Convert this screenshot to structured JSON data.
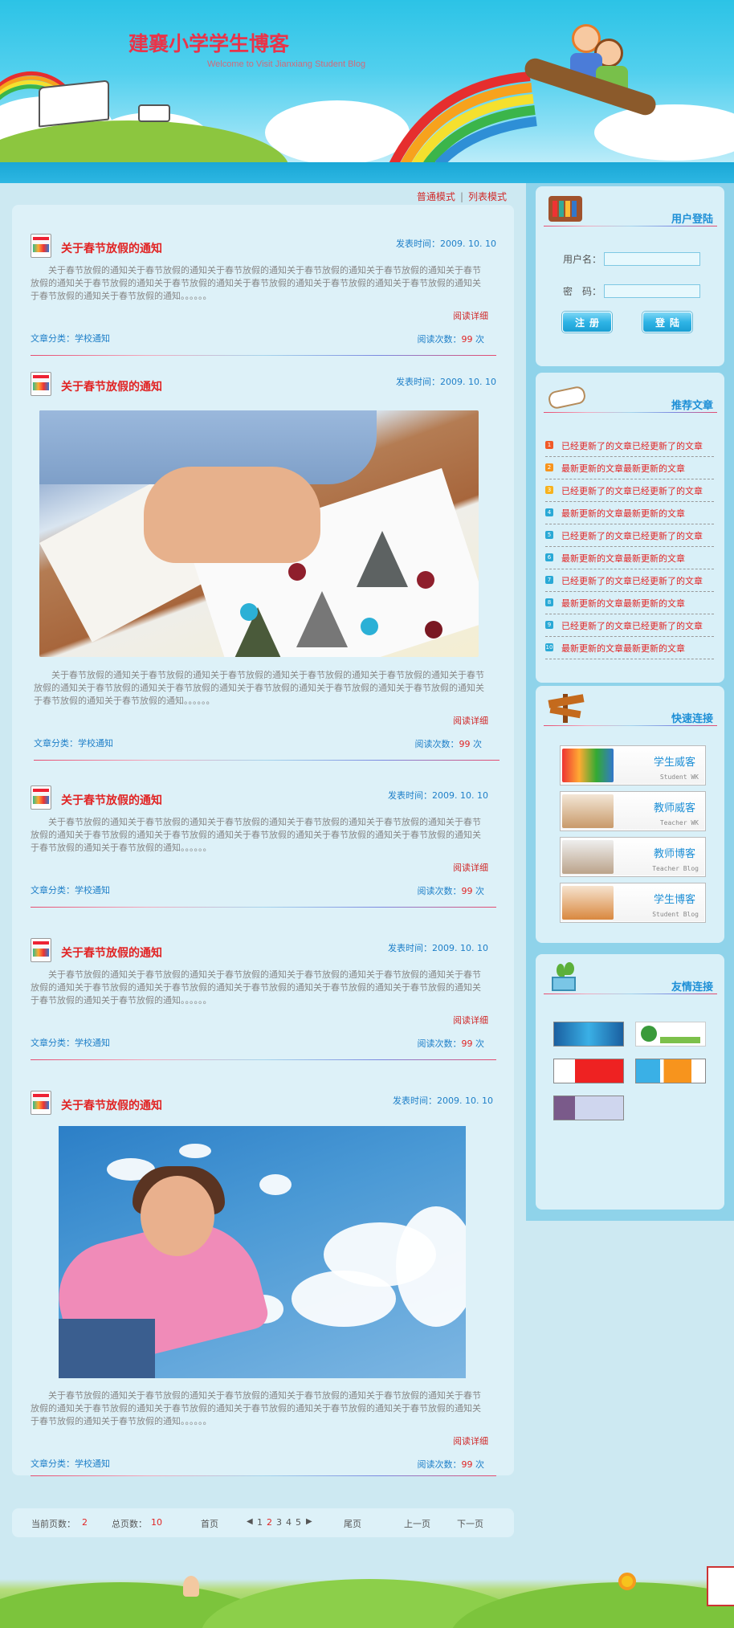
{
  "site": {
    "title": "建襄小学学生博客",
    "subtitle": "Welcome to Visit Jianxiang Student Blog"
  },
  "mode_bar": {
    "normal": "普通模式",
    "separator": "|",
    "list": "列表模式"
  },
  "articles": [
    {
      "title": "关于春节放假的通知",
      "date": "发表时间：2009. 10. 10",
      "body": "关于春节放假的通知关于春节放假的通知关于春节放假的通知关于春节放假的通知关于春节放假的通知关于春节放假的通知关于春节放假的通知关于春节放假的通知关于春节放假的通知关于春节放假的通知关于春节放假的通知关于春节放假的通知关于春节放假的通知。。。。。。",
      "more": "阅读详细",
      "category": "文章分类：学校通知",
      "read_prefix": "阅读次数：",
      "read_count": "99",
      "read_suffix": "次"
    },
    {
      "title": "关于春节放假的通知",
      "date": "发表时间：2009. 10. 10",
      "body": "关于春节放假的通知关于春节放假的通知关于春节放假的通知关于春节放假的通知关于春节放假的通知关于春节放假的通知关于春节放假的通知关于春节放假的通知关于春节放假的通知关于春节放假的通知关于春节放假的通知关于春节放假的通知关于春节放假的通知。。。。。。",
      "more": "阅读详细",
      "category": "文章分类：学校通知",
      "read_prefix": "阅读次数：",
      "read_count": "99",
      "read_suffix": "次"
    },
    {
      "title": "关于春节放假的通知",
      "date": "发表时间：2009. 10. 10",
      "body": "关于春节放假的通知关于春节放假的通知关于春节放假的通知关于春节放假的通知关于春节放假的通知关于春节放假的通知关于春节放假的通知关于春节放假的通知关于春节放假的通知关于春节放假的通知关于春节放假的通知关于春节放假的通知关于春节放假的通知。。。。。。",
      "more": "阅读详细",
      "category": "文章分类：学校通知",
      "read_prefix": "阅读次数：",
      "read_count": "99",
      "read_suffix": "次"
    },
    {
      "title": "关于春节放假的通知",
      "date": "发表时间：2009. 10. 10",
      "body": "关于春节放假的通知关于春节放假的通知关于春节放假的通知关于春节放假的通知关于春节放假的通知关于春节放假的通知关于春节放假的通知关于春节放假的通知关于春节放假的通知关于春节放假的通知关于春节放假的通知关于春节放假的通知关于春节放假的通知。。。。。。",
      "more": "阅读详细",
      "category": "文章分类：学校通知",
      "read_prefix": "阅读次数：",
      "read_count": "99",
      "read_suffix": "次"
    },
    {
      "title": "关于春节放假的通知",
      "date": "发表时间：2009. 10. 10",
      "body": "关于春节放假的通知关于春节放假的通知关于春节放假的通知关于春节放假的通知关于春节放假的通知关于春节放假的通知关于春节放假的通知关于春节放假的通知关于春节放假的通知关于春节放假的通知关于春节放假的通知关于春节放假的通知关于春节放假的通知。。。。。。",
      "more": "阅读详细",
      "category": "文章分类：学校通知",
      "read_prefix": "阅读次数：",
      "read_count": "99",
      "read_suffix": "次"
    }
  ],
  "pager": {
    "current_label": "当前页数：",
    "current": "2",
    "total_label": "总页数：",
    "total": "10",
    "first": "首页",
    "pages": [
      "1",
      "2",
      "3",
      "4",
      "5"
    ],
    "last": "尾页",
    "prev": "上一页",
    "next": "下一页"
  },
  "login": {
    "title": "用户登陆",
    "username_label": "用户名：",
    "password_label": "密　码：",
    "register": "注册",
    "login": "登陆"
  },
  "recommended": {
    "title": "推荐文章",
    "items": [
      {
        "num": "1",
        "text": "已经更新了的文章已经更新了的文章"
      },
      {
        "num": "2",
        "text": "最新更新的文章最新更新的文章"
      },
      {
        "num": "3",
        "text": "已经更新了的文章已经更新了的文章"
      },
      {
        "num": "4",
        "text": "最新更新的文章最新更新的文章"
      },
      {
        "num": "5",
        "text": "已经更新了的文章已经更新了的文章"
      },
      {
        "num": "6",
        "text": "最新更新的文章最新更新的文章"
      },
      {
        "num": "7",
        "text": "已经更新了的文章已经更新了的文章"
      },
      {
        "num": "8",
        "text": "最新更新的文章最新更新的文章"
      },
      {
        "num": "9",
        "text": "已经更新了的文章已经更新了的文章"
      },
      {
        "num": "10",
        "text": "最新更新的文章最新更新的文章"
      }
    ],
    "num_colors": [
      "#f05a28",
      "#f7941d",
      "#f7b21d",
      "#29a9d6",
      "#29a9d6",
      "#29a9d6",
      "#29a9d6",
      "#29a9d6",
      "#29a9d6",
      "#29a9d6"
    ]
  },
  "quick_links": {
    "title": "快速连接",
    "items": [
      {
        "main": "学生威客",
        "sub": "Student WK"
      },
      {
        "main": "教师威客",
        "sub": "Teacher WK"
      },
      {
        "main": "教师博客",
        "sub": "Teacher Blog"
      },
      {
        "main": "学生博客",
        "sub": "Student Blog"
      }
    ]
  },
  "friend_links": {
    "title": "友情连接"
  },
  "colors": {
    "accent_red": "#e12424",
    "accent_blue": "#1e8fd6",
    "sidebar_bg": "#8fd3ea",
    "content_bg": "#ddf1f8"
  }
}
